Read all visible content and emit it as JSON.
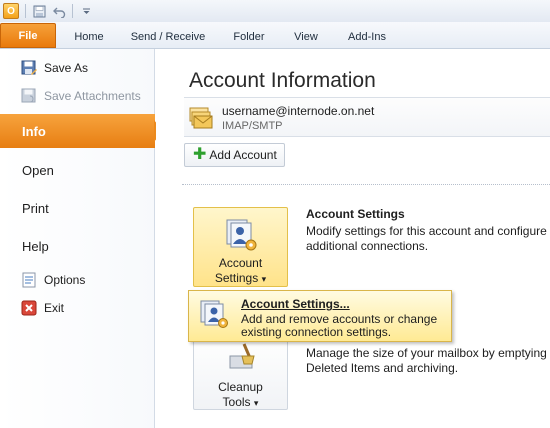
{
  "qat": {
    "app_icon_label": "O",
    "save_icon": "save-icon",
    "undo_icon": "undo-icon",
    "customize_icon": "customize-qat-icon"
  },
  "tabs": [
    {
      "label": "File"
    },
    {
      "label": "Home"
    },
    {
      "label": "Send / Receive"
    },
    {
      "label": "Folder"
    },
    {
      "label": "View"
    },
    {
      "label": "Add-Ins"
    }
  ],
  "nav": {
    "items": [
      {
        "label": "Save As",
        "icon": "save-as-icon"
      },
      {
        "label": "Save Attachments",
        "icon": "save-attachments-icon"
      },
      {
        "label": "Info"
      },
      {
        "label": "Open"
      },
      {
        "label": "Print"
      },
      {
        "label": "Help"
      },
      {
        "label": "Options",
        "icon": "options-icon"
      },
      {
        "label": "Exit",
        "icon": "exit-icon"
      }
    ]
  },
  "main": {
    "title": "Account Information",
    "account": {
      "name": "username@internode.on.net",
      "type": "IMAP/SMTP"
    },
    "add_account_label": "Add Account",
    "account_settings": {
      "tile_line1": "Account",
      "tile_line2": "Settings",
      "heading": "Account Settings",
      "description": "Modify settings for this account and configure additional connections."
    },
    "cleanup": {
      "tile_line1": "Cleanup",
      "tile_line2": "Tools",
      "description": "Manage the size of your mailbox by emptying Deleted Items and archiving."
    },
    "dropdown_arrow": "▾"
  },
  "popup": {
    "title": "Account Settings...",
    "description": "Add and remove accounts or change existing connection settings."
  },
  "colors": {
    "file_tab": "#e97a0c",
    "selected_nav": "#ec8a1d",
    "popup_bg": "#ffea94"
  }
}
